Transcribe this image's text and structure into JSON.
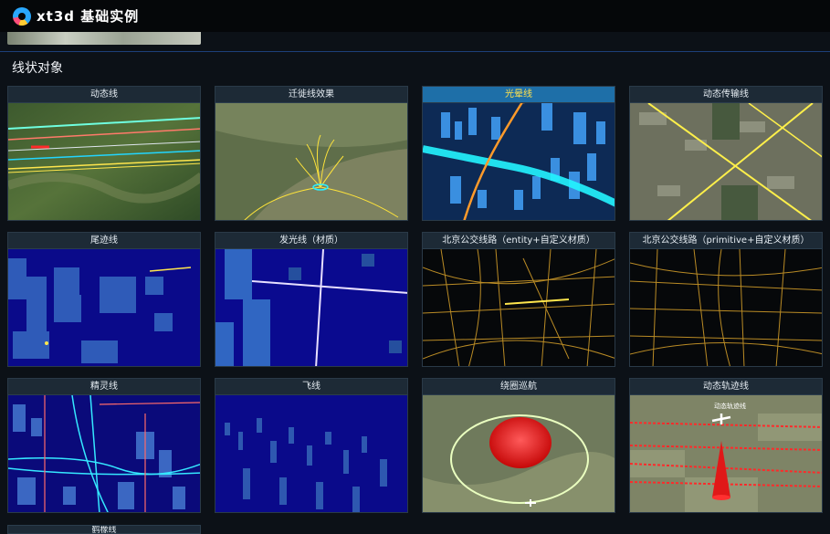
{
  "app": {
    "title": "xt3d 基础实例"
  },
  "section": {
    "title": "线状对象"
  },
  "cards": [
    {
      "label": "动态线"
    },
    {
      "label": "迁徙线效果"
    },
    {
      "label": "光晕线",
      "active": true
    },
    {
      "label": "动态传输线"
    },
    {
      "label": "尾迹线"
    },
    {
      "label": "发光线（材质）"
    },
    {
      "label": "北京公交线路（entity+自定义材质）"
    },
    {
      "label": "北京公交线路（primitive+自定义材质）"
    },
    {
      "label": "精灵线"
    },
    {
      "label": "飞线"
    },
    {
      "label": "绕圈巡航"
    },
    {
      "label": "动态轨迹线",
      "overlay_text": "动态轨迹线"
    }
  ],
  "next_card": {
    "label": "鹤橡线"
  },
  "colors": {
    "accent": "#1e6fa8",
    "active_title": "#ffe14d",
    "background": "#0c1117",
    "topbar": "#050709"
  }
}
